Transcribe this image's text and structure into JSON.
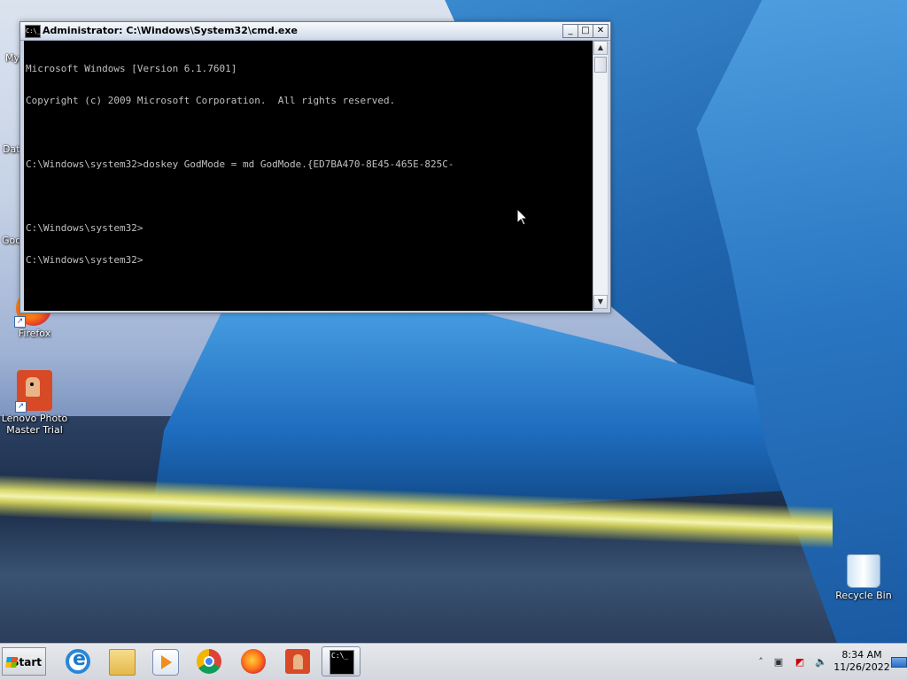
{
  "desktop": {
    "icons": [
      {
        "label": "Firefox"
      },
      {
        "label": "Lenovo Photo Master Trial"
      },
      {
        "label": "Recycle Bin"
      }
    ],
    "partial_labels": [
      "My",
      "Dat",
      "Goo"
    ]
  },
  "window": {
    "title": "Administrator: C:\\Windows\\System32\\cmd.exe",
    "icon_text": "C:\\_",
    "controls": {
      "minimize": "_",
      "maximize": "□",
      "close": "✕"
    },
    "console_lines": [
      "Microsoft Windows [Version 6.1.7601]",
      "Copyright (c) 2009 Microsoft Corporation.  All rights reserved.",
      "",
      "C:\\Windows\\system32>doskey GodMode = md GodMode.{ED7BA470-8E45-465E-825C-",
      "",
      "C:\\Windows\\system32>",
      "C:\\Windows\\system32>"
    ]
  },
  "taskbar": {
    "start_label": "Start",
    "pinned": [
      {
        "icon": "internet-explorer-icon"
      },
      {
        "icon": "folder-icon"
      },
      {
        "icon": "media-player-icon"
      },
      {
        "icon": "chrome-icon"
      },
      {
        "icon": "firefox-icon"
      },
      {
        "icon": "lenovo-photo-master-icon"
      },
      {
        "icon": "cmd-icon",
        "active": true
      }
    ],
    "tray": {
      "overflow": "˄",
      "time": "8:34 AM",
      "date": "11/26/2022"
    },
    "cmd_icon_text": "C:\\_"
  }
}
